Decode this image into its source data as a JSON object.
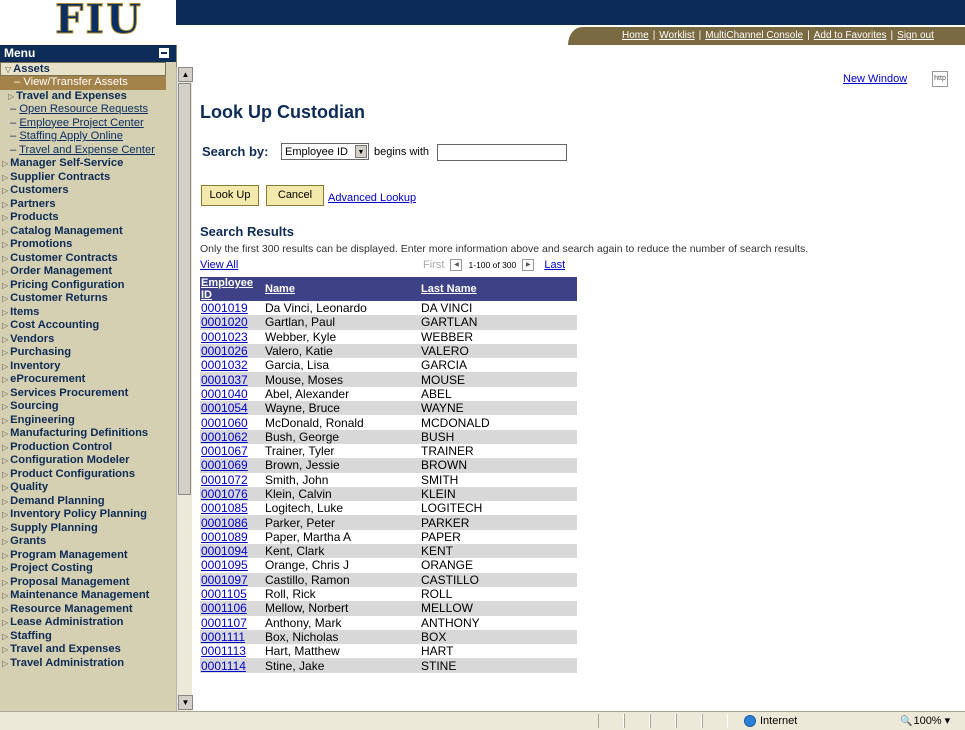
{
  "logo": "FIU",
  "top_nav": [
    "Home",
    "Worklist",
    "MultiChannel Console",
    "Add to Favorites",
    "Sign out"
  ],
  "menu": {
    "title": "Menu",
    "items": [
      {
        "label": "Assets",
        "kind": "open"
      },
      {
        "label": "– View/Transfer Assets",
        "kind": "sel"
      },
      {
        "label": "Travel and Expenses",
        "kind": "folder-indent"
      },
      {
        "label": "Open Resource Requests",
        "kind": "sub"
      },
      {
        "label": "Employee Project Center",
        "kind": "sub"
      },
      {
        "label": "Staffing Apply Online",
        "kind": "sub"
      },
      {
        "label": "Travel and Expense Center",
        "kind": "sub"
      },
      {
        "label": "Manager Self-Service",
        "kind": "folder"
      },
      {
        "label": "Supplier Contracts",
        "kind": "folder"
      },
      {
        "label": "Customers",
        "kind": "folder"
      },
      {
        "label": "Partners",
        "kind": "folder"
      },
      {
        "label": "Products",
        "kind": "folder"
      },
      {
        "label": "Catalog Management",
        "kind": "folder"
      },
      {
        "label": "Promotions",
        "kind": "folder"
      },
      {
        "label": "Customer Contracts",
        "kind": "folder"
      },
      {
        "label": "Order Management",
        "kind": "folder"
      },
      {
        "label": "Pricing Configuration",
        "kind": "folder"
      },
      {
        "label": "Customer Returns",
        "kind": "folder"
      },
      {
        "label": "Items",
        "kind": "folder"
      },
      {
        "label": "Cost Accounting",
        "kind": "folder"
      },
      {
        "label": "Vendors",
        "kind": "folder"
      },
      {
        "label": "Purchasing",
        "kind": "folder"
      },
      {
        "label": "Inventory",
        "kind": "folder"
      },
      {
        "label": "eProcurement",
        "kind": "folder"
      },
      {
        "label": "Services Procurement",
        "kind": "folder"
      },
      {
        "label": "Sourcing",
        "kind": "folder"
      },
      {
        "label": "Engineering",
        "kind": "folder"
      },
      {
        "label": "Manufacturing Definitions",
        "kind": "folder"
      },
      {
        "label": "Production Control",
        "kind": "folder"
      },
      {
        "label": "Configuration Modeler",
        "kind": "folder"
      },
      {
        "label": "Product Configurations",
        "kind": "folder"
      },
      {
        "label": "Quality",
        "kind": "folder"
      },
      {
        "label": "Demand Planning",
        "kind": "folder"
      },
      {
        "label": "Inventory Policy Planning",
        "kind": "folder"
      },
      {
        "label": "Supply Planning",
        "kind": "folder"
      },
      {
        "label": "Grants",
        "kind": "folder"
      },
      {
        "label": "Program Management",
        "kind": "folder"
      },
      {
        "label": "Project Costing",
        "kind": "folder"
      },
      {
        "label": "Proposal Management",
        "kind": "folder"
      },
      {
        "label": "Maintenance Management",
        "kind": "folder"
      },
      {
        "label": "Resource Management",
        "kind": "folder"
      },
      {
        "label": "Lease Administration",
        "kind": "folder"
      },
      {
        "label": "Staffing",
        "kind": "folder"
      },
      {
        "label": "Travel and Expenses",
        "kind": "folder"
      },
      {
        "label": "Travel Administration",
        "kind": "folder"
      }
    ]
  },
  "new_window": "New Window",
  "page_title": "Look Up Custodian",
  "search": {
    "label": "Search by:",
    "field": "Employee ID",
    "operator": "begins with",
    "value": ""
  },
  "buttons": {
    "lookup": "Look Up",
    "cancel": "Cancel",
    "advanced": "Advanced Lookup"
  },
  "results": {
    "title": "Search Results",
    "note": "Only the first 300 results can be displayed. Enter more information above and search again to reduce the number of search results.",
    "view_all": "View All",
    "pager": {
      "first": "First",
      "range": "1-100 of 300",
      "last": "Last"
    },
    "columns": [
      "Employee ID",
      "Name",
      "Last Name"
    ],
    "rows": [
      [
        "0001019",
        "Da Vinci, Leonardo",
        "DA VINCI"
      ],
      [
        "0001020",
        "Gartlan, Paul",
        "GARTLAN"
      ],
      [
        "0001023",
        "Webber, Kyle",
        "WEBBER"
      ],
      [
        "0001026",
        "Valero, Katie",
        "VALERO"
      ],
      [
        "0001032",
        "Garcia, Lisa",
        "GARCIA"
      ],
      [
        "0001037",
        "Mouse, Moses",
        "MOUSE"
      ],
      [
        "0001040",
        "Abel, Alexander",
        "ABEL"
      ],
      [
        "0001054",
        "Wayne, Bruce",
        "WAYNE"
      ],
      [
        "0001060",
        "McDonald, Ronald",
        "MCDONALD"
      ],
      [
        "0001062",
        "Bush, George",
        "BUSH"
      ],
      [
        "0001067",
        "Trainer, Tyler",
        "TRAINER"
      ],
      [
        "0001069",
        "Brown, Jessie",
        "BROWN"
      ],
      [
        "0001072",
        "Smith, John",
        "SMITH"
      ],
      [
        "0001076",
        "Klein, Calvin",
        "KLEIN"
      ],
      [
        "0001085",
        "Logitech, Luke",
        "LOGITECH"
      ],
      [
        "0001086",
        "Parker, Peter",
        "PARKER"
      ],
      [
        "0001089",
        "Paper, Martha A",
        "PAPER"
      ],
      [
        "0001094",
        "Kent, Clark",
        "KENT"
      ],
      [
        "0001095",
        "Orange, Chris J",
        "ORANGE"
      ],
      [
        "0001097",
        "Castillo, Ramon",
        "CASTILLO"
      ],
      [
        "0001105",
        "Roll, Rick",
        "ROLL"
      ],
      [
        "0001106",
        "Mellow, Norbert",
        "MELLOW"
      ],
      [
        "0001107",
        "Anthony, Mark",
        "ANTHONY"
      ],
      [
        "0001111",
        "Box, Nicholas",
        "BOX"
      ],
      [
        "0001113",
        "Hart, Matthew",
        "HART"
      ],
      [
        "0001114",
        "Stine, Jake",
        "STINE"
      ]
    ]
  },
  "status": {
    "zone": "Internet",
    "zoom": "100%"
  }
}
